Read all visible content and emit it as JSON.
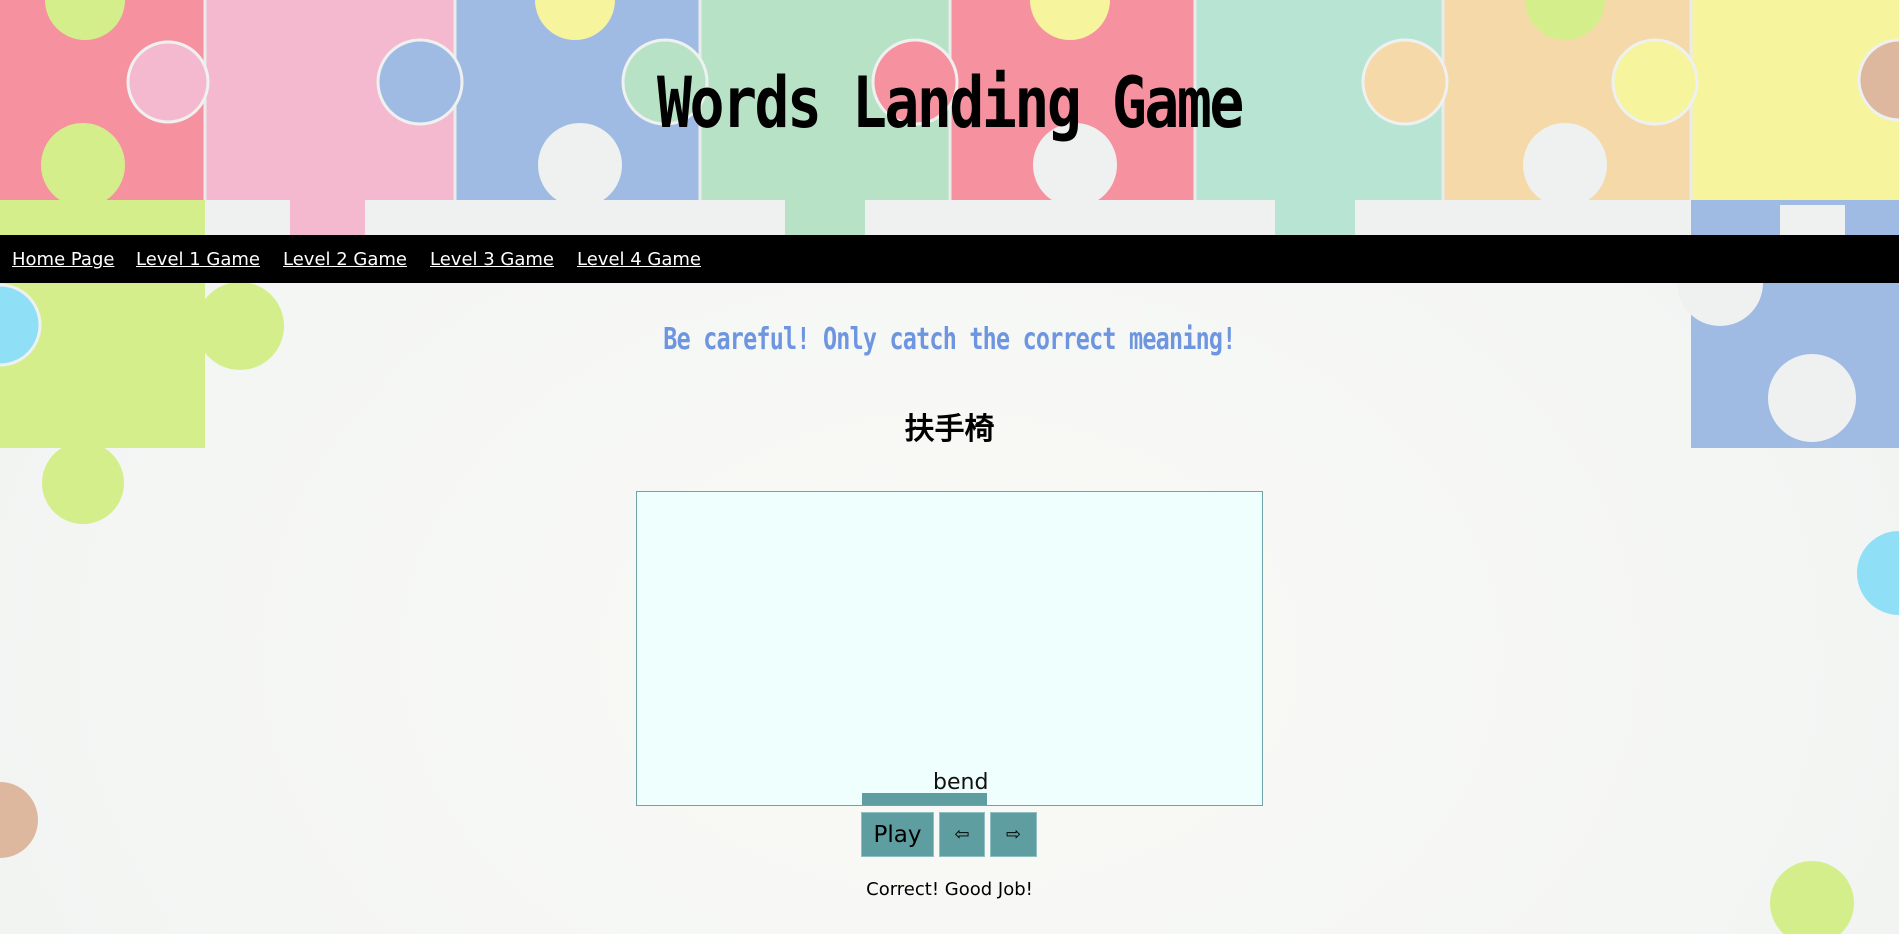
{
  "header": {
    "title": "Words Landing Game"
  },
  "nav": {
    "items": [
      {
        "label": "Home Page"
      },
      {
        "label": "Level 1 Game"
      },
      {
        "label": "Level 2 Game"
      },
      {
        "label": "Level 3 Game"
      },
      {
        "label": "Level 4 Game"
      }
    ]
  },
  "game": {
    "instruction": "Be careful! Only catch the correct meaning!",
    "target_word": "扶手椅",
    "falling_word": "bend",
    "controls": {
      "play_label": "Play",
      "left_label": "⇦",
      "right_label": "⇨"
    },
    "feedback": "Correct! Good Job!"
  },
  "colors": {
    "nav_background": "#000000",
    "instruction_text": "#6e95e0",
    "canvas_background": "#effffe",
    "button_fill": "#5e9ea0",
    "puzzle_red": "#f6929f",
    "puzzle_pink": "#f5b9cf",
    "puzzle_blue": "#9fbbe4",
    "puzzle_green": "#b8e2c5",
    "puzzle_mint": "#b8e4d4",
    "puzzle_orange": "#f5d9a9",
    "puzzle_yellow": "#f6f59d",
    "puzzle_lime": "#d5ee8c",
    "puzzle_cyan": "#8fdff7",
    "puzzle_tan": "#ddb89f"
  }
}
